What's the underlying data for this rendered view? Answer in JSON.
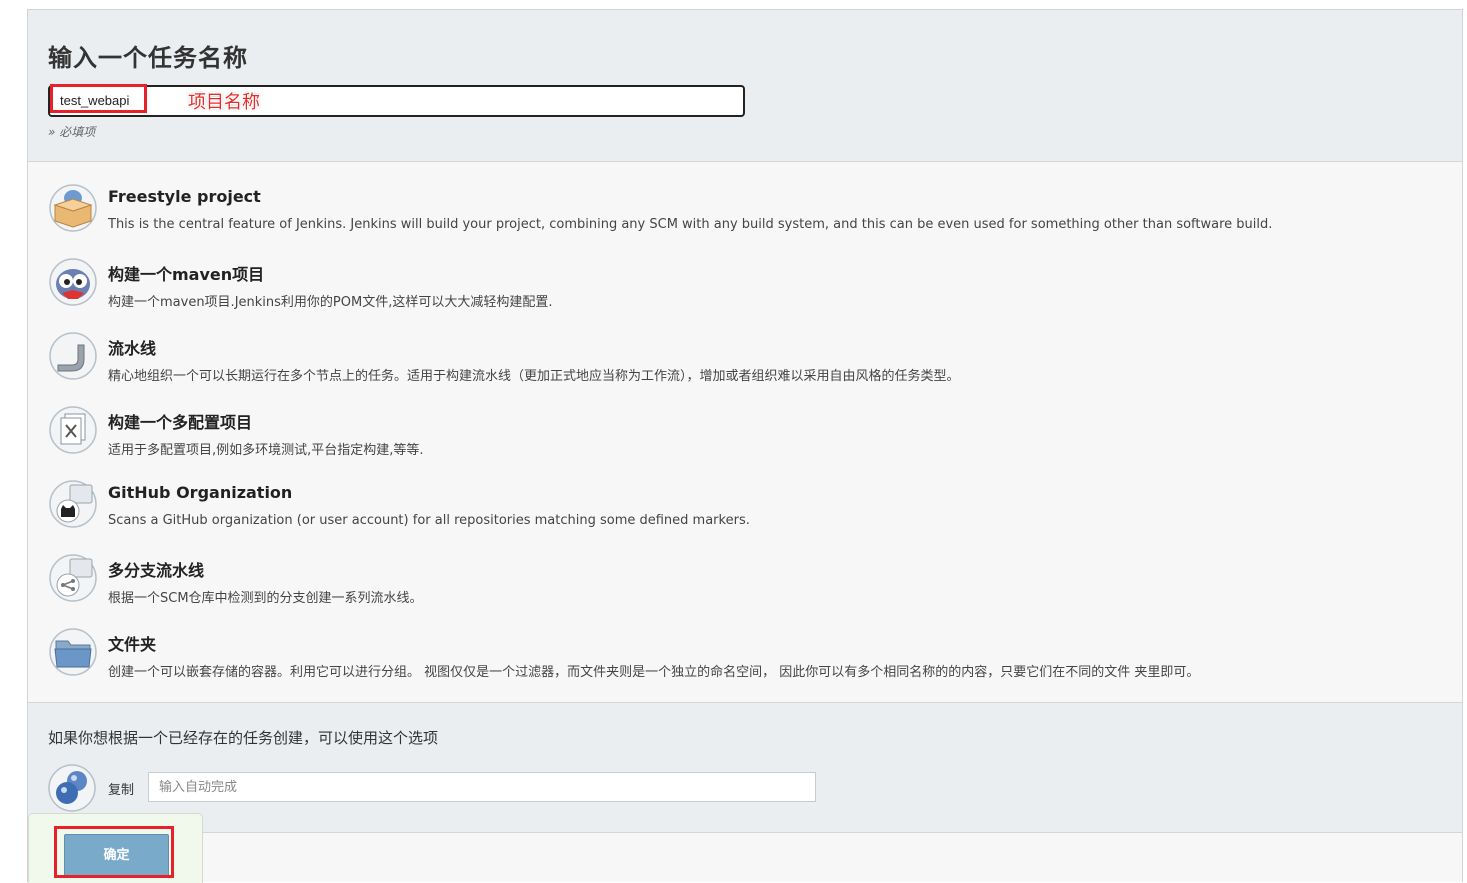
{
  "header": {
    "title": "输入一个任务名称",
    "name_value": "test_webapi",
    "annotation": "项目名称",
    "required_hint": "» 必填项"
  },
  "types": [
    {
      "title": "Freestyle project",
      "desc": "This is the central feature of Jenkins. Jenkins will build your project, combining any SCM with any build system, and this can be even used for something other than software build.",
      "icon": "freestyle-box-icon"
    },
    {
      "title": "构建一个maven项目",
      "desc": "构建一个maven项目.Jenkins利用你的POM文件,这样可以大大减轻构建配置.",
      "icon": "maven-owl-icon"
    },
    {
      "title": "流水线",
      "desc": "精心地组织一个可以长期运行在多个节点上的任务。适用于构建流水线（更加正式地应当称为工作流），增加或者组织难以采用自由风格的任务类型。",
      "icon": "pipeline-icon"
    },
    {
      "title": "构建一个多配置项目",
      "desc": "适用于多配置项目,例如多环境测试,平台指定构建,等等.",
      "icon": "multi-config-icon"
    },
    {
      "title": "GitHub Organization",
      "desc": "Scans a GitHub organization (or user account) for all repositories matching some defined markers.",
      "icon": "github-icon"
    },
    {
      "title": "多分支流水线",
      "desc": "根据一个SCM仓库中检测到的分支创建一系列流水线。",
      "icon": "multibranch-icon"
    },
    {
      "title": "文件夹",
      "desc": "创建一个可以嵌套存储的容器。利用它可以进行分组。 视图仅仅是一个过滤器，而文件夹则是一个独立的命名空间， 因此你可以有多个相同名称的的内容，只要它们在不同的文件 夹里即可。",
      "icon": "folder-icon"
    }
  ],
  "copy": {
    "heading": "如果你想根据一个已经存在的任务创建，可以使用这个选项",
    "label": "复制",
    "placeholder": "输入自动完成"
  },
  "footer": {
    "ok_label": "确定"
  },
  "colors": {
    "annotation_red": "#e8202a",
    "button_blue": "#7aaac9"
  }
}
